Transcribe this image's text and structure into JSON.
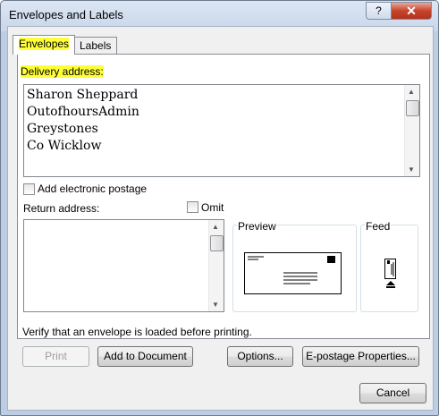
{
  "window": {
    "title": "Envelopes and Labels",
    "help_label": "?",
    "close_label": "✕"
  },
  "tabs": [
    {
      "label": "Envelopes",
      "active": true
    },
    {
      "label": "Labels",
      "active": false
    }
  ],
  "delivery": {
    "label": "Delivery address:",
    "lines": [
      "Sharon Sheppard",
      "OutofhoursAdmin",
      "Greystones",
      "Co Wicklow"
    ]
  },
  "electronic_postage": {
    "label": "Add electronic postage",
    "checked": false
  },
  "return_address": {
    "label": "Return address:",
    "value": ""
  },
  "omit": {
    "label": "Omit",
    "checked": false
  },
  "preview": {
    "label": "Preview"
  },
  "feed": {
    "label": "Feed"
  },
  "verify_text": "Verify that an envelope is loaded before printing.",
  "buttons": {
    "print": "Print",
    "add_to_document": "Add to Document",
    "options": "Options...",
    "epostage": "E-postage Properties...",
    "cancel": "Cancel"
  },
  "colors": {
    "highlight": "#ffff38",
    "title_bg": "#c9d7ea",
    "close_red": "#c8442c"
  }
}
